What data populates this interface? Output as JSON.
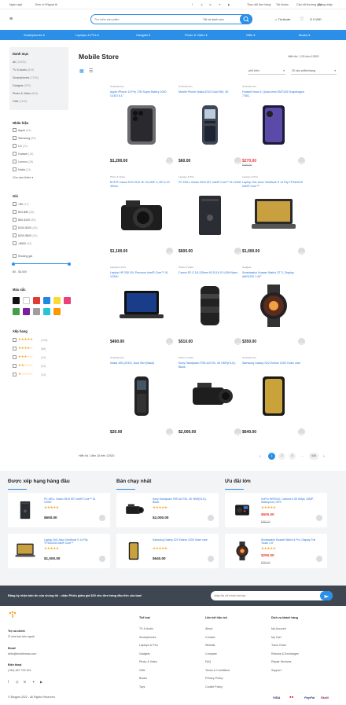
{
  "topbar": {
    "lang": "Ngôn ngữ",
    "currency": "Đơn vị ₫/Ngoại tệ",
    "links": [
      "Theo dõi đơn hàng",
      "Tài khoản",
      "Câu hỏi thường gặp",
      "Đăng nhập"
    ]
  },
  "header": {
    "search_placeholder": "Tìm kiếm sản phẩm",
    "category_select": "Tất cả danh mục",
    "account": "Tài khoản",
    "cart": "0 VND"
  },
  "nav": [
    "Smartphones",
    "Laptops & PCs",
    "Gadgets",
    "Photo & Video",
    "Gifts",
    "Books"
  ],
  "sidebar": {
    "category_title": "Danh mục",
    "categories": [
      {
        "label": "All",
        "count": "(12920)"
      },
      {
        "label": "TV & Audio",
        "count": "(819)"
      },
      {
        "label": "Smartphones",
        "count": "(7154)"
      },
      {
        "label": "Gadgets",
        "count": "(393)"
      },
      {
        "label": "Photo & Video",
        "count": "(815)"
      },
      {
        "label": "Gifts",
        "count": "(1106)"
      }
    ],
    "brand_title": "Nhãn hiệu",
    "brands": [
      {
        "label": "Apple",
        "count": "(81)"
      },
      {
        "label": "Samsung",
        "count": "(63)"
      },
      {
        "label": "LG",
        "count": "(21)"
      },
      {
        "label": "Huawei",
        "count": "(15)"
      },
      {
        "label": "Lenovo",
        "count": "(28)"
      },
      {
        "label": "Nokia",
        "count": "(11)"
      }
    ],
    "show_more": "Cho xem thêm ▾",
    "price_title": "Giá",
    "prices": [
      {
        "label": "<$0",
        "count": "(17)"
      },
      {
        "label": "$20-$50",
        "count": "(38)"
      },
      {
        "label": "$50-$100",
        "count": "(59)"
      },
      {
        "label": "$100-$200",
        "count": "(45)"
      },
      {
        "label": "$200-$500",
        "count": "(34)"
      },
      {
        "label": ">$500",
        "count": "(42)"
      }
    ],
    "custom_price": "Khoảng giá",
    "price_range": "$0 - $3,000",
    "color_title": "Màu sắc",
    "colors": [
      "#111111",
      "#ffffff",
      "#e53935",
      "#1e88e5",
      "#fdd835",
      "#ec407a",
      "#43a047",
      "#7b1fa2",
      "#9e9e9e",
      "#26c6da",
      "#ff9800"
    ],
    "rating_title": "Xếp hạng",
    "ratings": [
      {
        "stars": "★★★★★",
        "count": "(124)"
      },
      {
        "stars": "★★★★☆",
        "count": "(88)"
      },
      {
        "stars": "★★★☆☆",
        "count": "(41)"
      },
      {
        "stars": "★★☆☆☆",
        "count": "(22)"
      },
      {
        "stars": "★☆☆☆☆",
        "count": "(10)"
      }
    ]
  },
  "main": {
    "title": "Mobile Store",
    "results": "Hiển thị: 1-20 trên 12920",
    "sort": "phổ biến",
    "per_page": "20 sản phẩm/trang",
    "products": [
      {
        "cat": "Smartphones",
        "name": "Apple iPhone 14 Pro 1TB Super Batery 1000 OLED 6.1\"",
        "price": "$1,200.00",
        "old": "",
        "img": "iphone"
      },
      {
        "cat": "Smartphones",
        "name": "Mobile Phone Nokia 6210 Dual SIM, 4G",
        "price": "$60.00",
        "old": "",
        "img": "nokia"
      },
      {
        "cat": "Smartphones",
        "name": "Huawei Nova 9, Qualcomm SM7325 Snapdragon 778G,",
        "price": "$270.00",
        "old": "$300.00",
        "img": "huawei"
      },
      {
        "cat": "Photo & Video",
        "name": "B+B R Canon EOS R10 4K 24,2MP, 4, BF-5.1S 40mm",
        "price": "$1,100.00",
        "old": "",
        "img": "camera"
      },
      {
        "cat": "Laptops & PCs",
        "name": "PC DELL Vostro 3910 MT, Intel® Core™ i5-12400",
        "price": "$600.00",
        "old": "",
        "img": "tower"
      },
      {
        "cat": "Laptops & PCs",
        "name": "Laptop 2in1 Asus VivoBook S 14 Flip TP3402ZA Intel® Core™",
        "price": "$1,000.00",
        "old": "",
        "img": "laptop"
      },
      {
        "cat": "Laptops & PCs",
        "name": "Laptop HP 250 G9, Procesor Intel® Core™ i5-1235U",
        "price": "$490.00",
        "old": "",
        "img": "hplaptop"
      },
      {
        "cat": "Photo & Video",
        "name": "Canon EF-S 18-135mm f/3.5-5.6 IS USM Nano",
        "price": "$510.00",
        "old": "",
        "img": "lens"
      },
      {
        "cat": "Gadgets",
        "name": "Smartwatch Huawei Watch GT 3, Display AMOLED 1.43\"",
        "price": "$350.00",
        "old": "",
        "img": "watch"
      },
      {
        "cat": "Smartphones",
        "name": "Nokia 105 (2019), Dual Sim (Black)",
        "price": "$20.00",
        "old": "",
        "img": "nokia105"
      },
      {
        "cat": "Photo & Video",
        "name": "Sony Handycam FDR-AX700, 4K HDR(HLG), Black",
        "price": "$2,000.00",
        "old": "",
        "img": "camcorder"
      },
      {
        "cat": "Smartphones",
        "name": "Samsung Galaxy S22 Ewtron 2200 Outer care",
        "price": "$640.00",
        "old": "",
        "img": "galaxy"
      }
    ],
    "pagination_info": "Hiển thị 1 đến 16 trên 12920",
    "pages": [
      "1",
      "2",
      "3",
      "...",
      "545"
    ]
  },
  "widgets": [
    {
      "title": "Được xếp hạng hàng đầu",
      "items": [
        {
          "name": "PC DELL Vostro 3910 MT, Intel® Core™ i5-12400",
          "price": "$600.00",
          "old": "",
          "img": "tower"
        },
        {
          "name": "Laptop 2in1 Asus VivoBook S 14 Flip TP3402ZA Intel® Core™",
          "price": "$1,000.00",
          "old": "",
          "img": "laptop"
        }
      ]
    },
    {
      "title": "Bán chạy nhất",
      "items": [
        {
          "name": "Sony Handycam FDR-AX700, 4K HDR(HLG), Black",
          "price": "$2,000.00",
          "old": "",
          "img": "camcorder"
        },
        {
          "name": "Samsung Galaxy S22 Ewtron 2200 Outer care",
          "price": "$640.00",
          "old": "",
          "img": "galaxy"
        }
      ]
    },
    {
      "title": "Ưu đãi lớn",
      "items": [
        {
          "name": "GoPro HERO10, Camera 5.3K 60fps, 23MP, Waterproof, GPS",
          "price": "$500.00",
          "old": "$550.00",
          "img": "gopro"
        },
        {
          "name": "Smartwatch Huawei Watch 4 Pro, Display Full Touch 1.5\"",
          "price": "$250.00",
          "old": "$290.00",
          "img": "watch"
        }
      ]
    }
  ],
  "newsletter": {
    "text": "Đăng ký nhận bản tin của chúng tôi - nhận Phiếu giảm giá $20 cho đơn hàng đầu tiên của bạn!",
    "placeholder": "nhập địa chỉ email của bạn"
  },
  "footer": {
    "contact_title": "Trợ số chính",
    "contact_sub": "Ở nhà bạn bên ngoài",
    "email_title": "Email",
    "email": "hello@mobilemax.com",
    "phone_title": "Điện thoại",
    "phone": "(+84) 467 725 424",
    "cols": [
      {
        "title": "Thể loại",
        "items": [
          "TV & Audio",
          "Smartphones",
          "Laptops & PCs",
          "Gadgets",
          "Photo & Video",
          "Gifts",
          "Books",
          "Toys"
        ]
      },
      {
        "title": "Liên kết hữu ích",
        "items": [
          "About",
          "Contact",
          "Wishlist",
          "Compare",
          "FAQ",
          "Terms & Conditions",
          "Privacy Policy",
          "Cookie Policy"
        ]
      },
      {
        "title": "Dịch vụ khách hàng",
        "items": [
          "My Account",
          "My Cart",
          "Track Order",
          "Returns & Exchanges",
          "Repair Services",
          "Support"
        ]
      }
    ],
    "copyright": "© Blogpro 2022 - All Rights Reserved",
    "payments": [
      "VISA",
      "●●",
      "PayPal",
      "Skrill"
    ]
  },
  "colors": {
    "accent": "#2b8fe8",
    "sale": "#e53935",
    "star": "#f5a623",
    "dark": "#3e4651"
  }
}
